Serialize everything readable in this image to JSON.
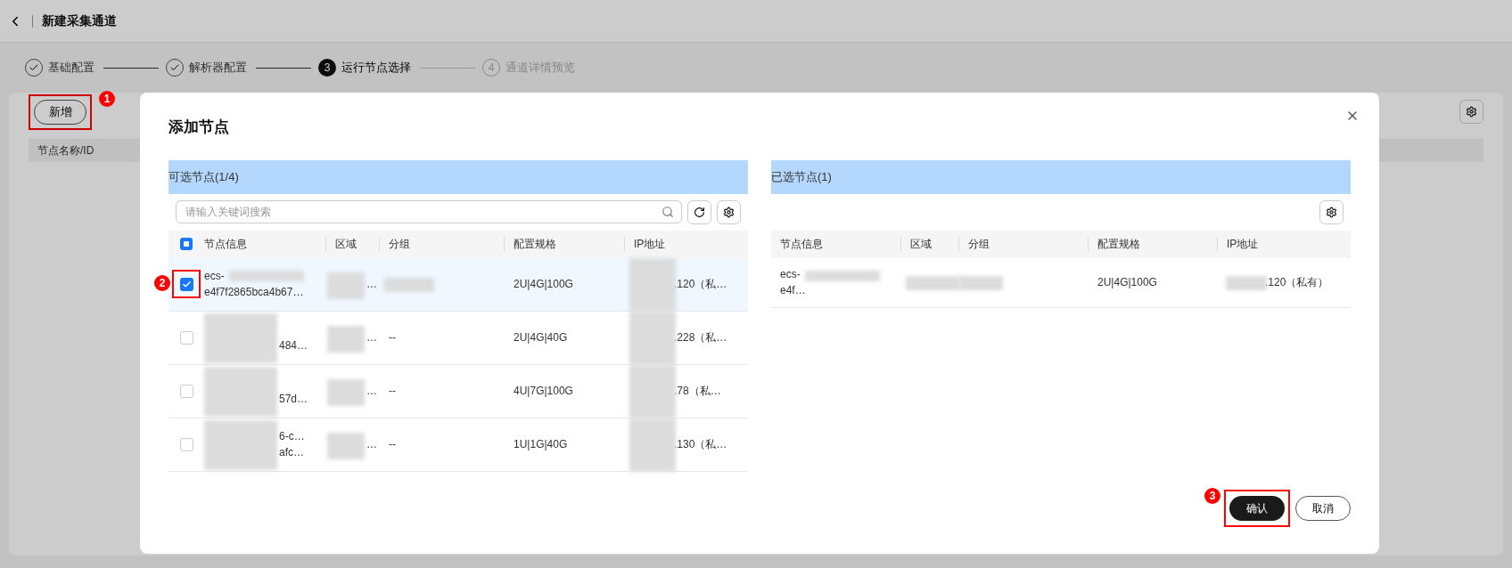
{
  "header": {
    "title": "新建采集通道"
  },
  "steps": [
    {
      "label": "基础配置",
      "completed": true,
      "current": false
    },
    {
      "label": "解析器配置",
      "completed": true,
      "current": false
    },
    {
      "label": "运行节点选择",
      "completed": false,
      "current": true,
      "number": "3"
    },
    {
      "label": "通道详情预览",
      "completed": false,
      "current": false,
      "number": "4"
    }
  ],
  "page": {
    "add_button": "新增",
    "add_marker": "1",
    "column": "节点名称/ID"
  },
  "dialog": {
    "title": "添加节点",
    "available": {
      "title": "可选节点(1/4)",
      "search_placeholder": "请输入关键词搜索",
      "select_all_indeterminate": true,
      "checkbox_marker": "2",
      "columns": [
        "节点信息",
        "区域",
        "分组",
        "配置规格",
        "IP地址"
      ],
      "rows": [
        {
          "selected": true,
          "node": {
            "kind": "tail_hidden",
            "line1": "ecs-",
            "line2": "e4f7f2865bca4b67…"
          },
          "region": "…",
          "spec": "2U|4G|100G",
          "ip": ".120（私…"
        },
        {
          "selected": false,
          "node": {
            "kind": "head_hidden",
            "line2": "484…"
          },
          "region": "…",
          "group": "--",
          "spec": "2U|4G|40G",
          "ip": ".228（私…"
        },
        {
          "selected": false,
          "node": {
            "kind": "head_hidden",
            "line2": "57d…"
          },
          "region": "…",
          "group": "--",
          "spec": "4U|7G|100G",
          "ip": ".78（私…"
        },
        {
          "selected": false,
          "node": {
            "kind": "head_hidden",
            "line1": "6-c…",
            "line2": "afc…"
          },
          "region": "…",
          "group": "--",
          "spec": "1U|1G|40G",
          "ip": ".130（私…"
        }
      ]
    },
    "selected": {
      "title": "已选节点(1)",
      "columns": [
        "节点信息",
        "区域",
        "分组",
        "配置规格",
        "IP地址"
      ],
      "rows": [
        {
          "node": {
            "kind": "tail_hidden",
            "line1": "ecs-",
            "line2": "e4f…"
          },
          "spec": "2U|4G|100G",
          "ip": ".120（私有）"
        }
      ]
    },
    "confirm": "确认",
    "confirm_marker": "3",
    "cancel": "取消"
  }
}
